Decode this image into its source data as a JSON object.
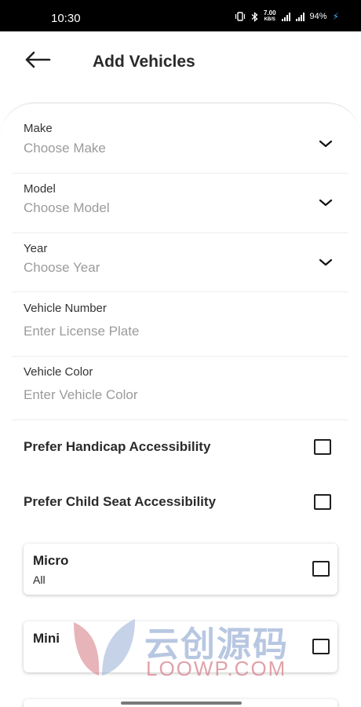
{
  "status_bar": {
    "time": "10:30",
    "net_speed_value": "7.00",
    "net_speed_unit": "KB/S",
    "battery": "94%",
    "icons": [
      "vibrate-icon",
      "bluetooth-icon",
      "signal-icon",
      "signal-icon",
      "charging-bolt-icon"
    ]
  },
  "header": {
    "title": "Add Vehicles",
    "back_icon": "arrow-left-icon"
  },
  "form": {
    "fields": [
      {
        "label": "Make",
        "value": "Choose Make",
        "kind": "dropdown"
      },
      {
        "label": "Model",
        "value": "Choose Model",
        "kind": "dropdown"
      },
      {
        "label": "Year",
        "value": "Choose Year",
        "kind": "dropdown"
      },
      {
        "label": "Vehicle Number",
        "placeholder": "Enter License Plate",
        "kind": "text"
      },
      {
        "label": "Vehicle Color",
        "placeholder": "Enter Vehicle Color",
        "kind": "text"
      }
    ],
    "preferences": [
      {
        "label": "Prefer Handicap Accessibility",
        "checked": false
      },
      {
        "label": "Prefer Child Seat Accessibility",
        "checked": false
      }
    ],
    "vehicle_types": [
      {
        "title": "Micro",
        "subtitle": "All",
        "checked": false
      },
      {
        "title": "Mini",
        "subtitle": "",
        "checked": false
      }
    ]
  },
  "watermark": {
    "text_cn": "云创源码",
    "text_en": "LOOWP.COM"
  },
  "colors": {
    "status_bar_bg": "#000000",
    "placeholder": "#9b9b9b",
    "text": "#1f1f1f",
    "charging": "#3cb0f0"
  }
}
